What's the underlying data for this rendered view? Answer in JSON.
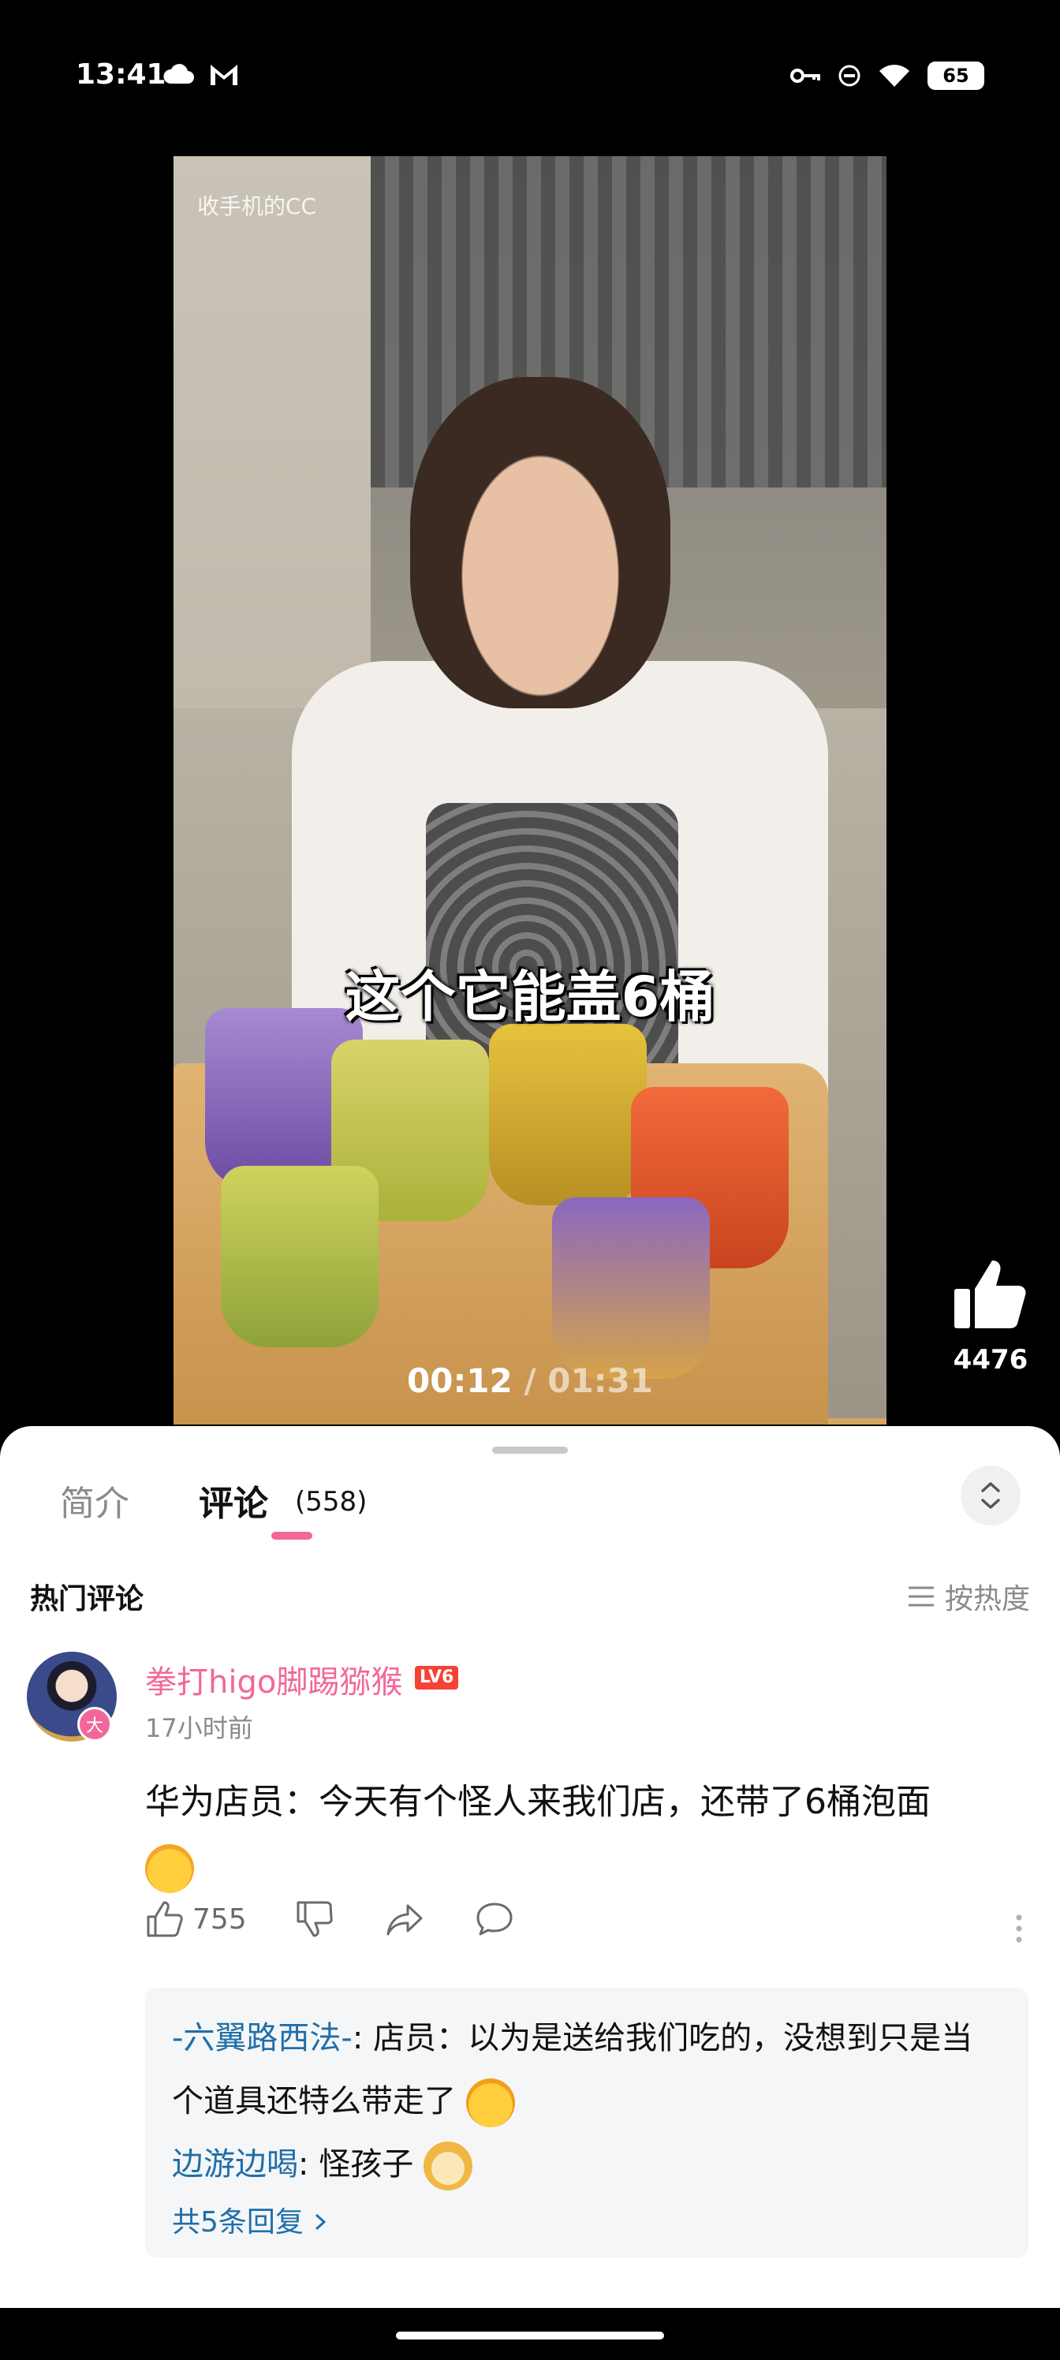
{
  "status_bar": {
    "time": "13:41",
    "left_icons": [
      "cloud-icon",
      "gmail-icon"
    ],
    "right_icons": [
      "vpn-key-icon",
      "do-not-disturb-icon",
      "wifi-icon"
    ],
    "battery": "65"
  },
  "video": {
    "watermark": "收手机的CC",
    "subtitle": "这个它能盖6桶",
    "current_time": "00:12",
    "separator": " / ",
    "total_time": "01:31"
  },
  "like": {
    "count": "4476"
  },
  "tabs": {
    "intro": "简介",
    "comments": "评论",
    "comments_count": "(558)"
  },
  "hot_comments": {
    "title": "热门评论",
    "sort_label": "按热度"
  },
  "comment": {
    "username": "拳打higo脚踢猕猴",
    "level": "LV6",
    "badge": "大",
    "time": "17小时前",
    "text": "华为店员：今天有个怪人来我们店，还带了6桶泡面",
    "likes": "755"
  },
  "replies": {
    "items": [
      {
        "user": "-六翼路西法-",
        "text": ": 店员：以为是送给我们吃的，没想到只是当个道具还特么带走了"
      },
      {
        "user": "边游边喝",
        "text": ": 怪孩子"
      }
    ],
    "more": "共5条回复"
  },
  "colors": {
    "accent_pink": "#f2679b",
    "reply_blue": "#1f6fa8",
    "level_red": "#f44336"
  }
}
